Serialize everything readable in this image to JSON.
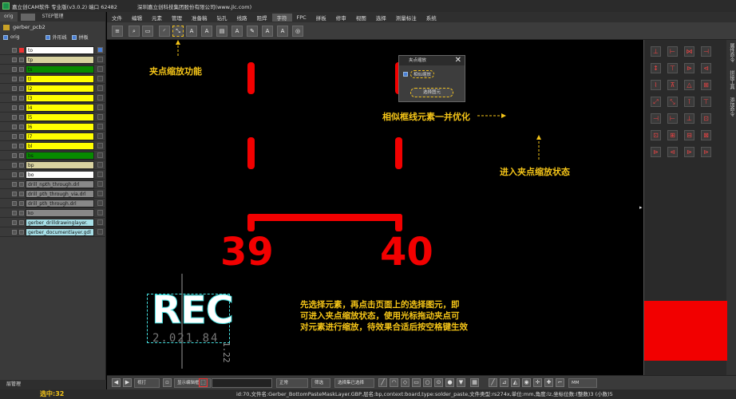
{
  "titlebar": {
    "title": "嘉立创CAM软件 专业版(v3.0.2) 端口 62482",
    "company": "深圳嘉立创科技集团股份有限公司(www.jlc.com)"
  },
  "left_panel": {
    "tabs": [
      "orig",
      "STEP管理"
    ],
    "pcb_name": "gerber_pcb2",
    "options": {
      "root": "orig",
      "outline": "外形线",
      "panel": "拼板"
    },
    "layers": [
      {
        "name": "to",
        "color": "#ffffff",
        "selected": true
      },
      {
        "name": "tp",
        "color": "#d8d2a0"
      },
      {
        "name": "ts",
        "color": "#078a00"
      },
      {
        "name": "tl",
        "color": "#ffff00"
      },
      {
        "name": "l2",
        "color": "#ffff00"
      },
      {
        "name": "l3",
        "color": "#ffff00"
      },
      {
        "name": "l4",
        "color": "#ffff00"
      },
      {
        "name": "l5",
        "color": "#ffff00"
      },
      {
        "name": "l6",
        "color": "#ffff00"
      },
      {
        "name": "l7",
        "color": "#ffff00"
      },
      {
        "name": "bl",
        "color": "#ffff00"
      },
      {
        "name": "bs",
        "color": "#078a00"
      },
      {
        "name": "bp",
        "color": "#d8d2a0"
      },
      {
        "name": "bo",
        "color": "#ffffff"
      },
      {
        "name": "drill_npth_through.drl",
        "color": "#888888"
      },
      {
        "name": "drill_pth_through_via.drl",
        "color": "#888888"
      },
      {
        "name": "drill_pth_through.drl",
        "color": "#888888"
      },
      {
        "name": "ko",
        "color": "#888888"
      },
      {
        "name": "gerber_drilldrawinglayer. ...",
        "color": "#a8e0e8"
      },
      {
        "name": "gerber_documentlayer.gdl",
        "color": "#a8e0e8"
      }
    ],
    "footer": "层管理"
  },
  "menubar": [
    "文件",
    "编辑",
    "元素",
    "管理",
    "准备稿",
    "钻孔",
    "线路",
    "阻焊",
    "字符",
    "FPC",
    "拼板",
    "修审",
    "视图",
    "选择",
    "测量标注",
    "系统"
  ],
  "menubar_active": "字符",
  "canvas": {
    "ann_feature": "夹点缩放功能",
    "ann_similar": "相似框线元素一并优化",
    "ann_enter": "进入夹点缩放状态",
    "ann_help": "先选择元素，再点击页面上的选择图元，即\n可进入夹点缩放状态，使用光标拖动夹点可\n对元素进行缩放，待效果合适后按空格键生效",
    "num_left": "39",
    "num_right": "40",
    "rec": "REC",
    "rec_sub": "2.021.84",
    "rec_side": "1.22"
  },
  "popup": {
    "title": "夹点缩放",
    "checkbox": "相似缩放",
    "button": "选择图元"
  },
  "right_panel": {
    "vtabs": [
      "属性命令",
      "拼接工具",
      "添加命令"
    ]
  },
  "bottombar": {
    "mode": "视打",
    "display": "显示编辑框",
    "line": "正常",
    "filter": "筛选",
    "select_all": "选择集已选择",
    "unit": "MM"
  },
  "status": {
    "selected": "选中:32",
    "info": "id:70,文件名:Gerber_BottomPasteMaskLayer.GBP,层名:bp,context:board,type:solder_paste,文件类型:rs274x,单位:mm,角度:lz,坐标位数:(整数)3 (小数)5"
  }
}
